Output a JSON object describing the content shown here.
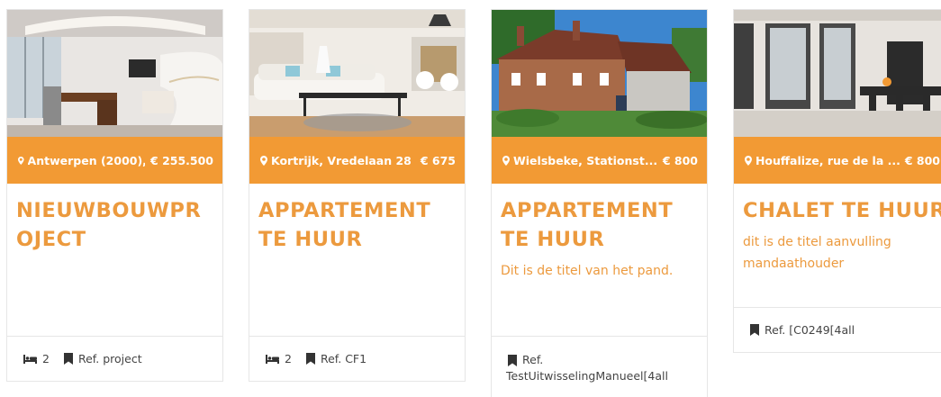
{
  "theme": {
    "accent": "#f0952f",
    "title_color": "#ec9a3e",
    "bar_color": "#f29a34"
  },
  "cards": [
    {
      "location": "Antwerpen (2000), k...",
      "price": "€ 255.500",
      "title": "NIEUWBOUWPROJECT",
      "subtitle": "",
      "bedrooms": "2",
      "reference": "Ref. project"
    },
    {
      "location": "Kortrijk, Vredelaan 28",
      "price": "€ 675",
      "title": "APPARTEMENT TE HUUR",
      "subtitle": "",
      "bedrooms": "2",
      "reference": "Ref. CF1"
    },
    {
      "location": "Wielsbeke, Stationst...",
      "price": "€ 800",
      "title": "APPARTEMENT TE HUUR",
      "subtitle": "Dit is de titel van het pand.",
      "reference_label": "Ref.",
      "reference_value": "TestUitwisselingManueel[4all"
    },
    {
      "location": "Houffalize, rue de la ...",
      "price": "€ 800",
      "title": "CHALET TE HUUR",
      "subtitle": "dit is de titel aanvulling mandaathouder",
      "reference": "Ref. [C0249[4all"
    }
  ]
}
